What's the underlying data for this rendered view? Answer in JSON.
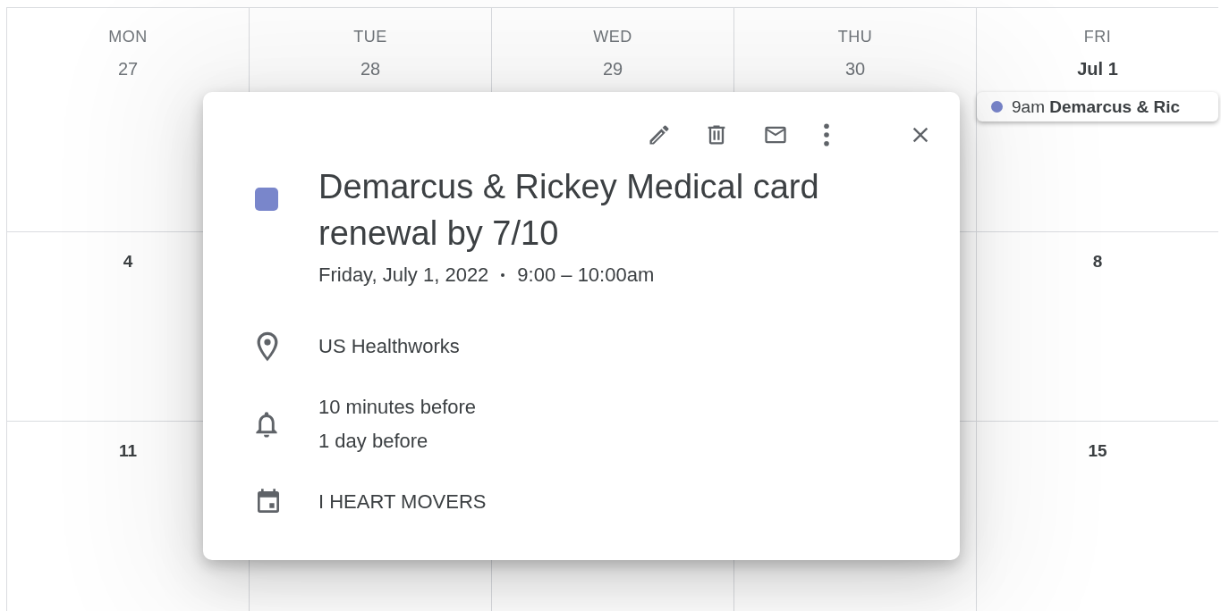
{
  "days": [
    {
      "name": "MON",
      "date": "27",
      "kind": "day"
    },
    {
      "name": "TUE",
      "date": "28",
      "kind": "day"
    },
    {
      "name": "WED",
      "date": "29",
      "kind": "day"
    },
    {
      "name": "THU",
      "date": "30",
      "kind": "day"
    },
    {
      "name": "FRI",
      "date": "Jul 1",
      "kind": "month_start",
      "events": [
        {
          "time": "9am",
          "title": "Demarcus & Ric",
          "color": "#7986cb"
        }
      ]
    }
  ],
  "weeks": [
    {
      "mon": "4",
      "fri": "8"
    },
    {
      "mon": "11",
      "fri": "15"
    }
  ],
  "popup": {
    "color": "#7986cb",
    "title": "Demarcus & Rickey Medical card renewal by 7/10",
    "date": "Friday, July 1, 2022",
    "time": "9:00 – 10:00am",
    "details": [
      {
        "kind": "location",
        "lines": [
          "US Healthworks"
        ]
      },
      {
        "kind": "reminders",
        "lines": [
          "10 minutes before",
          "1 day before"
        ]
      },
      {
        "kind": "calendar",
        "lines": [
          "I HEART MOVERS"
        ]
      }
    ]
  }
}
